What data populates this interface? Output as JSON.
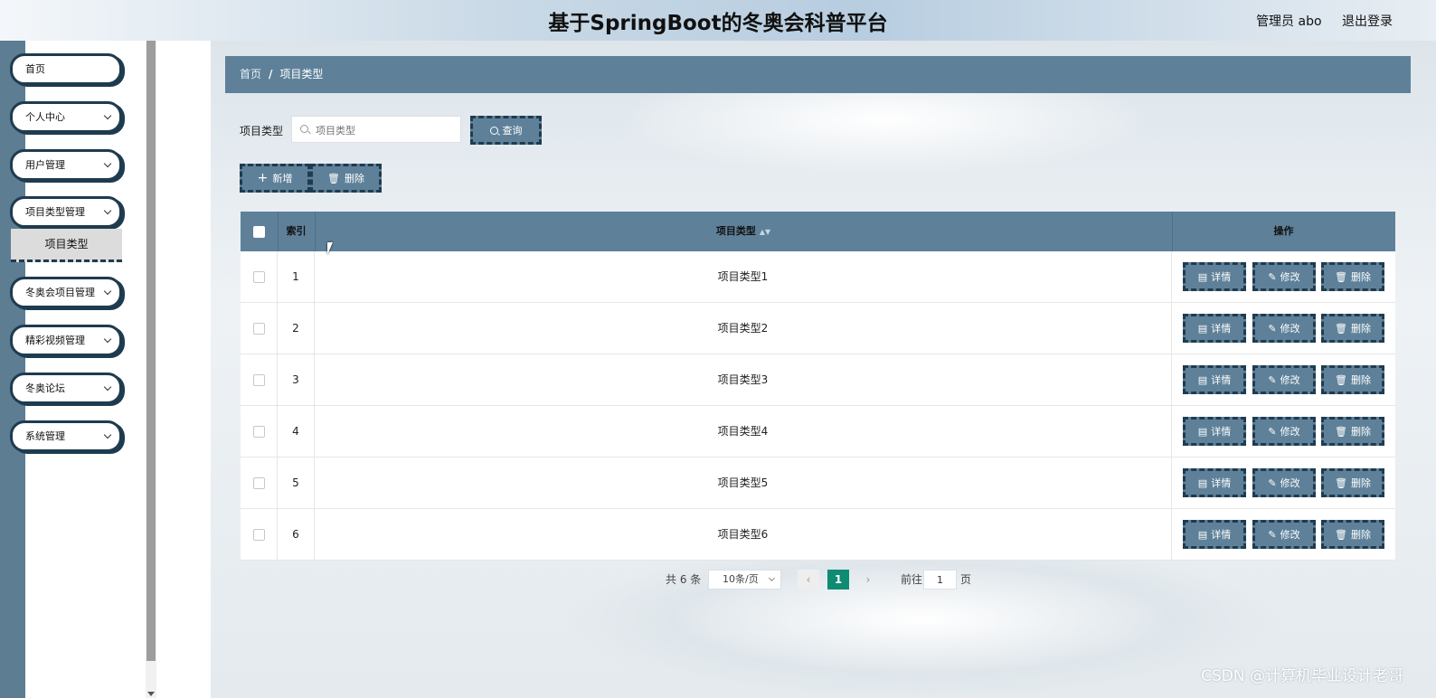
{
  "header": {
    "title": "基于SpringBoot的冬奥会科普平台",
    "user": "管理员 abo",
    "logout": "退出登录"
  },
  "sidebar": {
    "items": [
      {
        "label": "首页",
        "expandable": false
      },
      {
        "label": "个人中心",
        "expandable": true
      },
      {
        "label": "用户管理",
        "expandable": true
      },
      {
        "label": "项目类型管理",
        "expandable": true
      },
      {
        "label": "冬奥会项目管理",
        "expandable": true
      },
      {
        "label": "精彩视频管理",
        "expandable": true
      },
      {
        "label": "冬奥论坛",
        "expandable": true
      },
      {
        "label": "系统管理",
        "expandable": true
      }
    ],
    "active_sub": "项目类型"
  },
  "breadcrumb": {
    "home": "首页",
    "separator": "/",
    "current": "项目类型"
  },
  "search": {
    "label": "项目类型",
    "placeholder": "项目类型",
    "query_button": "查询"
  },
  "actions": {
    "add_button": "新增",
    "delete_button": "删除"
  },
  "table": {
    "columns": [
      "索引",
      "项目类型",
      "操作"
    ],
    "rows": [
      {
        "index": "1",
        "type": "项目类型1"
      },
      {
        "index": "2",
        "type": "项目类型2"
      },
      {
        "index": "3",
        "type": "项目类型3"
      },
      {
        "index": "4",
        "type": "项目类型4"
      },
      {
        "index": "5",
        "type": "项目类型5"
      },
      {
        "index": "6",
        "type": "项目类型6"
      }
    ],
    "row_actions": {
      "detail": "详情",
      "edit": "修改",
      "delete": "删除"
    }
  },
  "pagination": {
    "total": "共 6 条",
    "page_size": "10条/页",
    "current_page": "1",
    "goto_label": "前往",
    "goto_value": "1",
    "page_suffix": "页"
  },
  "watermark": "CSDN @计算机毕业设计老哥",
  "colors": {
    "accent": "#5e8199",
    "border_dark": "#1f3b4f",
    "page_active": "#0e8b73"
  }
}
